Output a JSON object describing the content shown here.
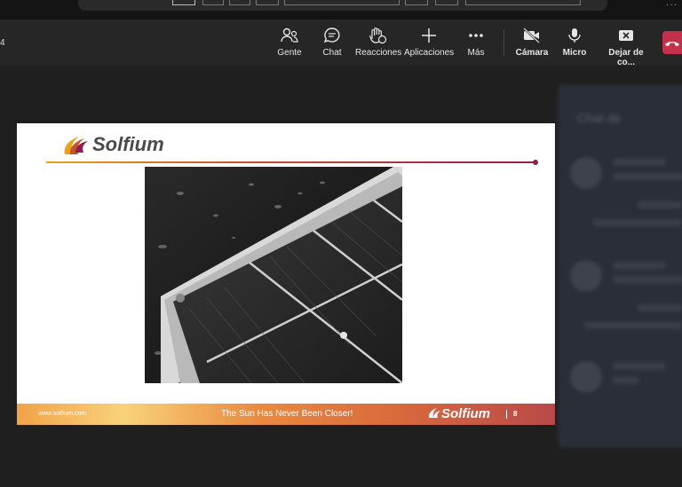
{
  "meeting_controls": {
    "edge_label": "4",
    "buttons": [
      {
        "label": "Gente",
        "icon": "people-icon"
      },
      {
        "label": "Chat",
        "icon": "chat-icon"
      },
      {
        "label": "Reacciones",
        "icon": "reactions-icon"
      },
      {
        "label": "Aplicaciones",
        "icon": "plus-icon"
      },
      {
        "label": "Más",
        "icon": "more-icon"
      },
      {
        "label": "Cámara",
        "icon": "camera-off-icon"
      },
      {
        "label": "Micro",
        "icon": "microphone-icon"
      },
      {
        "label": "Dejar de co...",
        "icon": "stop-share-icon"
      }
    ],
    "leave_color": "#c4314b"
  },
  "slide": {
    "brand": "Solfium",
    "tagline": "The Sun Has Never Been Closer!",
    "website": "www.solfium.com",
    "page_number": "8",
    "accent_colors": [
      "#e8a317",
      "#c2542d",
      "#8e1e4f"
    ]
  },
  "chat_panel": {
    "title": "Chat de"
  }
}
